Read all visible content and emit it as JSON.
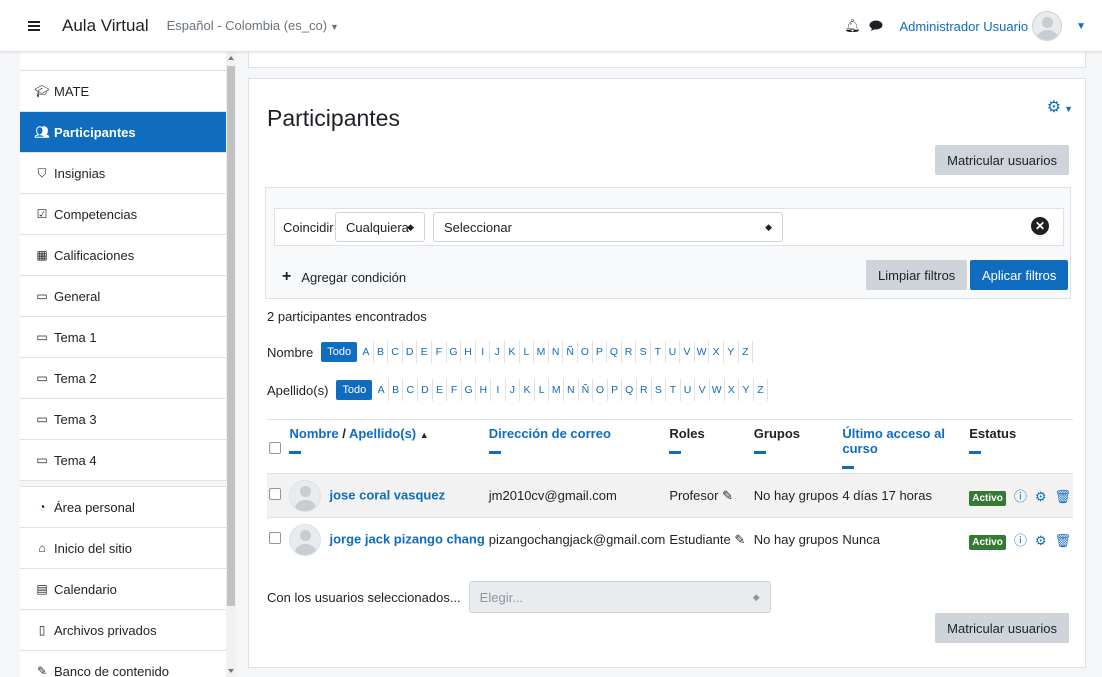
{
  "navbar": {
    "brand": "Aula Virtual",
    "language": "Español - Colombia (es_co)",
    "user_name": "Administrador Usuario"
  },
  "sidebar": {
    "items": [
      {
        "label": "MATE",
        "icon": "graduation-cap-icon"
      },
      {
        "label": "Participantes",
        "icon": "users-icon",
        "active": true
      },
      {
        "label": "Insignias",
        "icon": "shield-icon"
      },
      {
        "label": "Competencias",
        "icon": "check-square-icon"
      },
      {
        "label": "Calificaciones",
        "icon": "table-icon"
      },
      {
        "label": "General",
        "icon": "folder-icon"
      },
      {
        "label": "Tema 1",
        "icon": "folder-icon"
      },
      {
        "label": "Tema 2",
        "icon": "folder-icon"
      },
      {
        "label": "Tema 3",
        "icon": "folder-icon"
      },
      {
        "label": "Tema 4",
        "icon": "folder-icon"
      }
    ],
    "items2": [
      {
        "label": "Área personal",
        "icon": "dashboard-icon"
      },
      {
        "label": "Inicio del sitio",
        "icon": "home-icon"
      },
      {
        "label": "Calendario",
        "icon": "calendar-icon"
      },
      {
        "label": "Archivos privados",
        "icon": "file-icon"
      },
      {
        "label": "Banco de contenido",
        "icon": "paint-brush-icon"
      }
    ]
  },
  "main": {
    "title": "Participantes",
    "enrol_button": "Matricular usuarios",
    "filter": {
      "match_label": "Coincidir",
      "match_value": "Cualquiera",
      "select_value": "Seleccionar",
      "add_condition": "Agregar condición",
      "clear_button": "Limpiar filtros",
      "apply_button": "Aplicar filtros"
    },
    "found": "2 participantes encontrados",
    "initials": {
      "first_label": "Nombre",
      "last_label": "Apellido(s)",
      "all": "Todo",
      "letters": [
        "A",
        "B",
        "C",
        "D",
        "E",
        "F",
        "G",
        "H",
        "I",
        "J",
        "K",
        "L",
        "M",
        "N",
        "Ñ",
        "O",
        "P",
        "Q",
        "R",
        "S",
        "T",
        "U",
        "V",
        "W",
        "X",
        "Y",
        "Z"
      ]
    },
    "table": {
      "col_name_first": "Nombre",
      "col_name_sep": " / ",
      "col_name_last": "Apellido(s)",
      "col_email": "Dirección de correo",
      "col_roles": "Roles",
      "col_groups": "Grupos",
      "col_access": "Último acceso al curso",
      "col_status": "Estatus",
      "rows": [
        {
          "name": "jose coral vasquez",
          "email": "jm2010cv@gmail.com",
          "role": "Profesor",
          "groups": "No hay grupos",
          "access": "4 días 17 horas",
          "status": "Activo"
        },
        {
          "name": "jorge jack pizango chang",
          "email": "pizangochangjack@gmail.com",
          "role": "Estudiante",
          "groups": "No hay grupos",
          "access": "Nunca",
          "status": "Activo"
        }
      ]
    },
    "bulk": {
      "label": "Con los usuarios seleccionados...",
      "placeholder": "Elegir..."
    }
  }
}
